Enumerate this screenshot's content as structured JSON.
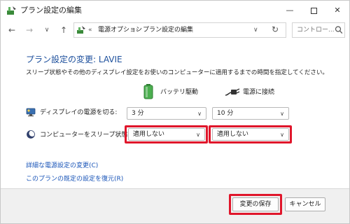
{
  "window": {
    "title": "プラン設定の編集"
  },
  "nav": {
    "back": "←",
    "forward": "→",
    "dropdown": "∨",
    "up": "↑"
  },
  "address": {
    "prefix": "«",
    "crumb1": "電源オプション",
    "separator": "›",
    "crumb2": "プラン設定の編集",
    "dropdown": "∨",
    "refresh": "↻"
  },
  "search": {
    "placeholder": "コントロー..."
  },
  "main": {
    "heading": "プラン設定の変更: LAVIE",
    "description": "スリープ状態やその他のディスプレイ設定をお使いのコンピューターに適用するまでの時間を指定してください。",
    "columns": {
      "battery": "バッテリ駆動",
      "plugged": "電源に接続"
    },
    "rows": [
      {
        "label": "ディスプレイの電源を切る:",
        "battery_value": "3 分",
        "plugged_value": "10 分"
      },
      {
        "label": "コンピューターをスリープ状態にする:",
        "battery_value": "適用しない",
        "plugged_value": "適用しない"
      }
    ],
    "links": {
      "advanced": "詳細な電源設定の変更(C)",
      "restore": "このプランの既定の設定を復元(R)"
    }
  },
  "footer": {
    "save": "変更の保存",
    "cancel": "キャンセル"
  },
  "colors": {
    "heading": "#1c4f9c",
    "link": "#1a55b8",
    "highlight": "#e0162b"
  }
}
